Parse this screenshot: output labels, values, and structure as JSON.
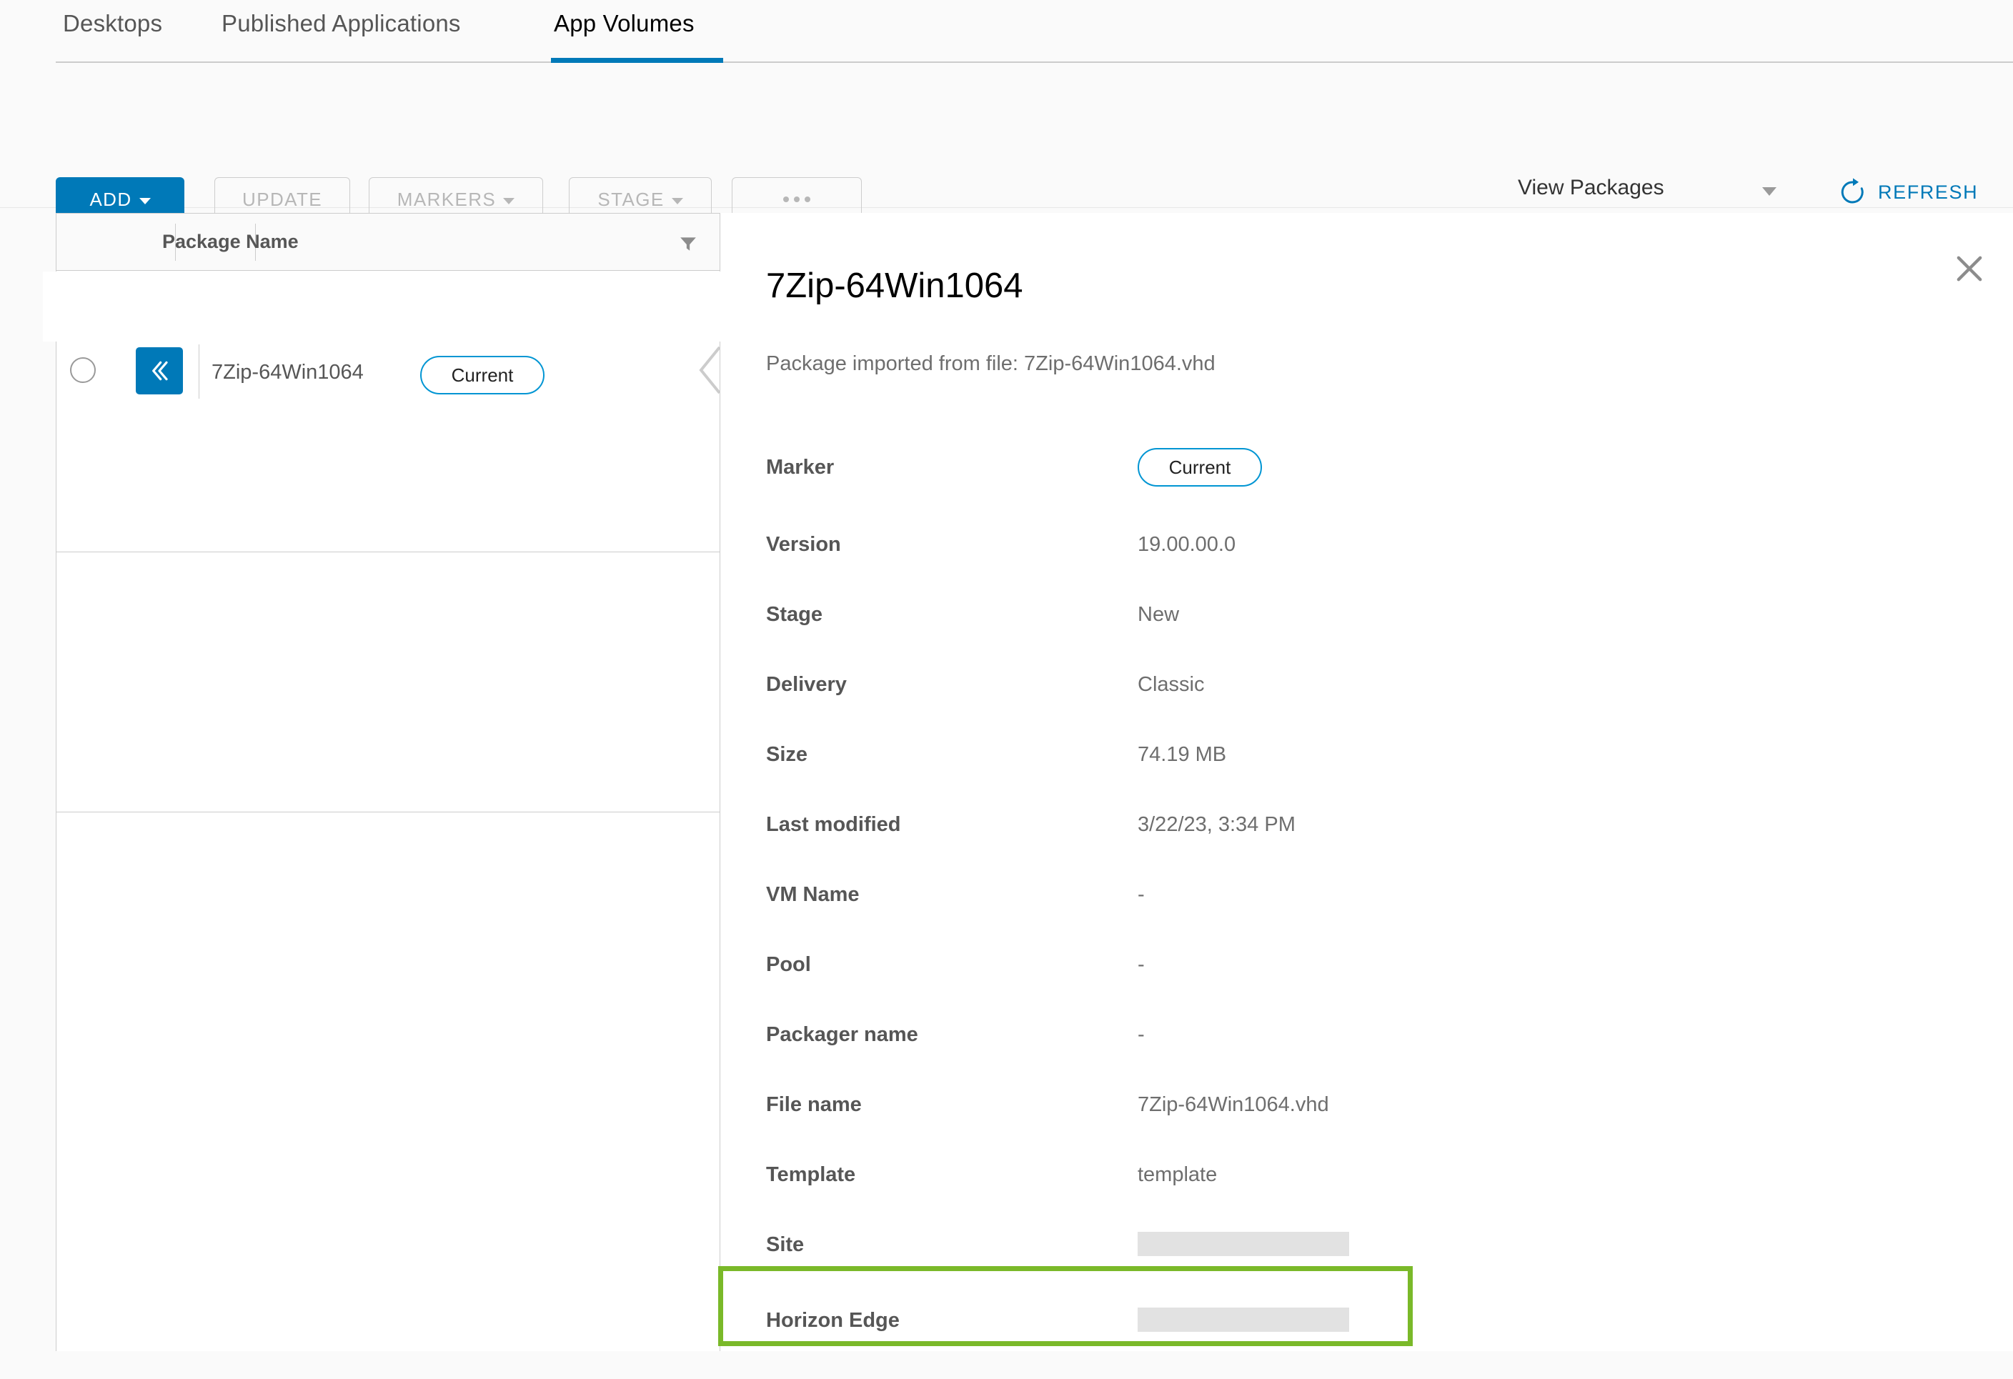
{
  "tabs": [
    {
      "label": "Desktops",
      "active": false
    },
    {
      "label": "Published Applications",
      "active": false
    },
    {
      "label": "App Volumes",
      "active": true
    }
  ],
  "toolbar": {
    "add_label": "ADD",
    "update_label": "UPDATE",
    "markers_label": "MARKERS",
    "stage_label": "STAGE",
    "more_label": "...",
    "view_select_value": "View Packages",
    "refresh_label": "REFRESH"
  },
  "table": {
    "column_header": "Package Name",
    "rows": [
      {
        "name": "7Zip-64Win1064",
        "marker": "Current"
      }
    ]
  },
  "detail": {
    "title": "7Zip-64Win1064",
    "subtitle": "Package imported from file: 7Zip-64Win1064.vhd",
    "fields": [
      {
        "label": "Marker",
        "value": "Current",
        "type": "badge"
      },
      {
        "label": "Version",
        "value": "19.00.00.0",
        "type": "text"
      },
      {
        "label": "Stage",
        "value": "New",
        "type": "text"
      },
      {
        "label": "Delivery",
        "value": "Classic",
        "type": "text"
      },
      {
        "label": "Size",
        "value": "74.19 MB",
        "type": "text"
      },
      {
        "label": "Last modified",
        "value": "3/22/23, 3:34 PM",
        "type": "text"
      },
      {
        "label": "VM Name",
        "value": "-",
        "type": "text"
      },
      {
        "label": "Pool",
        "value": "-",
        "type": "text"
      },
      {
        "label": "Packager name",
        "value": "-",
        "type": "text"
      },
      {
        "label": "File name",
        "value": "7Zip-64Win1064.vhd",
        "type": "text"
      },
      {
        "label": "Template",
        "value": "template",
        "type": "text"
      },
      {
        "label": "Site",
        "value": "",
        "type": "redacted"
      },
      {
        "label": "Horizon Edge",
        "value": "",
        "type": "redacted"
      }
    ]
  },
  "colors": {
    "primary_blue": "#0079b8",
    "badge_blue": "#0095d3",
    "highlight_green": "#7ab929",
    "redaction_gray": "#e2e2e2"
  }
}
